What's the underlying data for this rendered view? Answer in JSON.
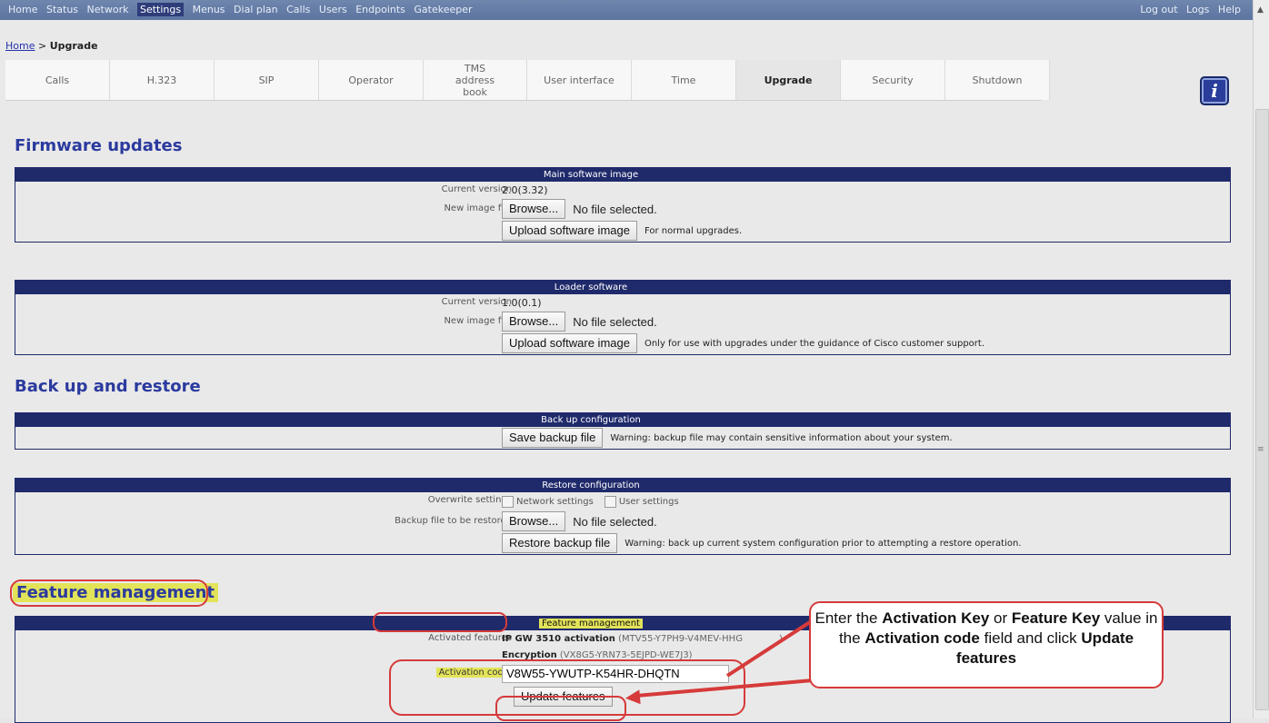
{
  "topnav": {
    "items": [
      "Home",
      "Status",
      "Network",
      "Settings",
      "Menus",
      "Dial plan",
      "Calls",
      "Users",
      "Endpoints",
      "Gatekeeper"
    ],
    "active_index": 3,
    "right_items": [
      "Log out",
      "Logs",
      "Help"
    ]
  },
  "breadcrumb": {
    "home": "Home",
    "sep": ">",
    "current": "Upgrade"
  },
  "tabs": [
    {
      "label": "Calls"
    },
    {
      "label": "H.323"
    },
    {
      "label": "SIP"
    },
    {
      "label": "Operator"
    },
    {
      "label": "TMS address book"
    },
    {
      "label": "User interface"
    },
    {
      "label": "Time"
    },
    {
      "label": "Upgrade"
    },
    {
      "label": "Security"
    },
    {
      "label": "Shutdown"
    }
  ],
  "active_tab_index": 7,
  "icons": {
    "info": "info-icon"
  },
  "firmware": {
    "title": "Firmware updates",
    "main": {
      "header": "Main software image",
      "current_version_label": "Current version",
      "current_version": "2.0(3.32)",
      "new_image_label": "New image file",
      "browse": "Browse...",
      "no_file": "No file selected.",
      "upload": "Upload software image",
      "note": "For normal upgrades."
    },
    "loader": {
      "header": "Loader software",
      "current_version_label": "Current version",
      "current_version": "1.0(0.1)",
      "new_image_label": "New image file",
      "browse": "Browse...",
      "no_file": "No file selected.",
      "upload": "Upload software image",
      "note": "Only for use with upgrades under the guidance of Cisco customer support."
    }
  },
  "backup": {
    "title": "Back up and restore",
    "backup_config": {
      "header": "Back up configuration",
      "save": "Save backup file",
      "note": "Warning: backup file may contain sensitive information about your system."
    },
    "restore_config": {
      "header": "Restore configuration",
      "overwrite_label": "Overwrite settings",
      "network_settings": "Network settings",
      "user_settings": "User settings",
      "file_label": "Backup file to be restored",
      "browse": "Browse...",
      "no_file": "No file selected.",
      "restore": "Restore backup file",
      "note": "Warning: back up current system configuration prior to attempting a restore operation."
    }
  },
  "features": {
    "title": "Feature management",
    "header": "Feature management",
    "activated_label": "Activated features",
    "feature1_name": "IP GW 3510 activation",
    "feature1_key": "(MTV55-Y7PH9-V4MEV-HHG",
    "feature1_key_tail": ")",
    "feature2_name": "Encryption",
    "feature2_key": "(VX8G5-YRN73-5EJPD-WE7J3)",
    "activation_label": "Activation code",
    "activation_value": "V8W55-YWUTP-K54HR-DHQTN",
    "update": "Update features"
  },
  "callout": {
    "t1": "Enter the ",
    "b1": "Activation Key",
    "t2": " or ",
    "b2": "Feature Key",
    "t3": " value in the ",
    "b3": "Activation code",
    "t4": " field and click ",
    "b4": "Update features",
    "accent": "#d63a3a"
  }
}
